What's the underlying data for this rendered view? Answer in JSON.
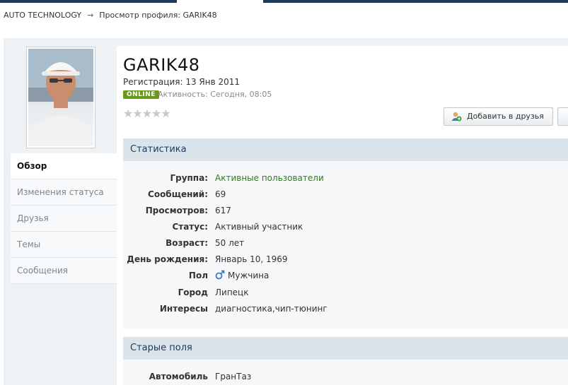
{
  "breadcrumb": {
    "root": "AUTO TECHNOLOGY",
    "arrow": "→",
    "current": "Просмотр профиля: GARIK48"
  },
  "profile": {
    "username": "GARIK48",
    "registration": "Регистрация: 13 Янв 2011",
    "online_badge": "ONLINE",
    "activity": "Активность: Сегодня, 08:05",
    "stars": "★★★★★",
    "rating_stars": 0,
    "add_friend_label": "Добавить в друзья"
  },
  "nav": {
    "items": [
      {
        "label": "Обзор"
      },
      {
        "label": "Изменения статуса"
      },
      {
        "label": "Друзья"
      },
      {
        "label": "Темы"
      },
      {
        "label": "Сообщения"
      }
    ]
  },
  "stats": {
    "title": "Статистика",
    "rows": [
      {
        "label": "Группа:",
        "value": "Активные пользователи"
      },
      {
        "label": "Сообщений:",
        "value": "69"
      },
      {
        "label": "Просмотров:",
        "value": "617"
      },
      {
        "label": "Статус:",
        "value": "Активный участник"
      },
      {
        "label": "Возраст:",
        "value": "50 лет"
      },
      {
        "label": "День рождения:",
        "value": "Январь 10, 1969"
      },
      {
        "label": "Пол",
        "value": "Мужчина"
      },
      {
        "label": "Город",
        "value": "Липецк"
      },
      {
        "label": "Интересы",
        "value": "диагностика,чип-тюнинг"
      }
    ]
  },
  "old_fields": {
    "title": "Старые поля",
    "rows": [
      {
        "label": "Автомобиль",
        "value": "ГранТаз"
      }
    ]
  },
  "colors": {
    "accent": "#1c3b5a",
    "online": "#6a9a1a",
    "group_value": "#2e7d1a"
  }
}
